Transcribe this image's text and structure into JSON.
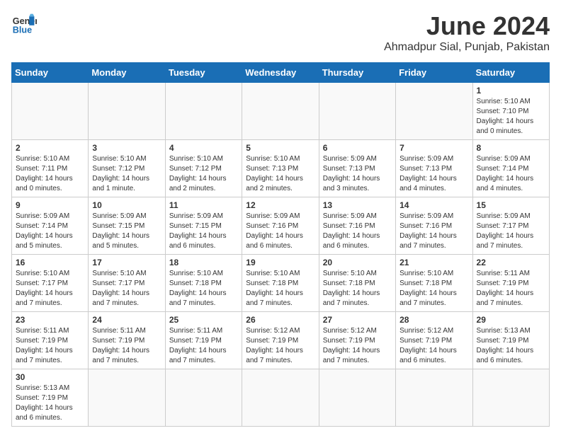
{
  "header": {
    "logo_general": "General",
    "logo_blue": "Blue",
    "month_title": "June 2024",
    "location": "Ahmadpur Sial, Punjab, Pakistan"
  },
  "weekdays": [
    "Sunday",
    "Monday",
    "Tuesday",
    "Wednesday",
    "Thursday",
    "Friday",
    "Saturday"
  ],
  "weeks": [
    [
      {
        "day": "",
        "info": ""
      },
      {
        "day": "",
        "info": ""
      },
      {
        "day": "",
        "info": ""
      },
      {
        "day": "",
        "info": ""
      },
      {
        "day": "",
        "info": ""
      },
      {
        "day": "",
        "info": ""
      },
      {
        "day": "1",
        "info": "Sunrise: 5:10 AM\nSunset: 7:10 PM\nDaylight: 14 hours\nand 0 minutes."
      }
    ],
    [
      {
        "day": "2",
        "info": "Sunrise: 5:10 AM\nSunset: 7:11 PM\nDaylight: 14 hours\nand 0 minutes."
      },
      {
        "day": "3",
        "info": "Sunrise: 5:10 AM\nSunset: 7:12 PM\nDaylight: 14 hours\nand 1 minute."
      },
      {
        "day": "4",
        "info": "Sunrise: 5:10 AM\nSunset: 7:12 PM\nDaylight: 14 hours\nand 2 minutes."
      },
      {
        "day": "5",
        "info": "Sunrise: 5:10 AM\nSunset: 7:13 PM\nDaylight: 14 hours\nand 2 minutes."
      },
      {
        "day": "6",
        "info": "Sunrise: 5:09 AM\nSunset: 7:13 PM\nDaylight: 14 hours\nand 3 minutes."
      },
      {
        "day": "7",
        "info": "Sunrise: 5:09 AM\nSunset: 7:13 PM\nDaylight: 14 hours\nand 4 minutes."
      },
      {
        "day": "8",
        "info": "Sunrise: 5:09 AM\nSunset: 7:14 PM\nDaylight: 14 hours\nand 4 minutes."
      }
    ],
    [
      {
        "day": "9",
        "info": "Sunrise: 5:09 AM\nSunset: 7:14 PM\nDaylight: 14 hours\nand 5 minutes."
      },
      {
        "day": "10",
        "info": "Sunrise: 5:09 AM\nSunset: 7:15 PM\nDaylight: 14 hours\nand 5 minutes."
      },
      {
        "day": "11",
        "info": "Sunrise: 5:09 AM\nSunset: 7:15 PM\nDaylight: 14 hours\nand 6 minutes."
      },
      {
        "day": "12",
        "info": "Sunrise: 5:09 AM\nSunset: 7:16 PM\nDaylight: 14 hours\nand 6 minutes."
      },
      {
        "day": "13",
        "info": "Sunrise: 5:09 AM\nSunset: 7:16 PM\nDaylight: 14 hours\nand 6 minutes."
      },
      {
        "day": "14",
        "info": "Sunrise: 5:09 AM\nSunset: 7:16 PM\nDaylight: 14 hours\nand 7 minutes."
      },
      {
        "day": "15",
        "info": "Sunrise: 5:09 AM\nSunset: 7:17 PM\nDaylight: 14 hours\nand 7 minutes."
      }
    ],
    [
      {
        "day": "16",
        "info": "Sunrise: 5:10 AM\nSunset: 7:17 PM\nDaylight: 14 hours\nand 7 minutes."
      },
      {
        "day": "17",
        "info": "Sunrise: 5:10 AM\nSunset: 7:17 PM\nDaylight: 14 hours\nand 7 minutes."
      },
      {
        "day": "18",
        "info": "Sunrise: 5:10 AM\nSunset: 7:18 PM\nDaylight: 14 hours\nand 7 minutes."
      },
      {
        "day": "19",
        "info": "Sunrise: 5:10 AM\nSunset: 7:18 PM\nDaylight: 14 hours\nand 7 minutes."
      },
      {
        "day": "20",
        "info": "Sunrise: 5:10 AM\nSunset: 7:18 PM\nDaylight: 14 hours\nand 7 minutes."
      },
      {
        "day": "21",
        "info": "Sunrise: 5:10 AM\nSunset: 7:18 PM\nDaylight: 14 hours\nand 7 minutes."
      },
      {
        "day": "22",
        "info": "Sunrise: 5:11 AM\nSunset: 7:19 PM\nDaylight: 14 hours\nand 7 minutes."
      }
    ],
    [
      {
        "day": "23",
        "info": "Sunrise: 5:11 AM\nSunset: 7:19 PM\nDaylight: 14 hours\nand 7 minutes."
      },
      {
        "day": "24",
        "info": "Sunrise: 5:11 AM\nSunset: 7:19 PM\nDaylight: 14 hours\nand 7 minutes."
      },
      {
        "day": "25",
        "info": "Sunrise: 5:11 AM\nSunset: 7:19 PM\nDaylight: 14 hours\nand 7 minutes."
      },
      {
        "day": "26",
        "info": "Sunrise: 5:12 AM\nSunset: 7:19 PM\nDaylight: 14 hours\nand 7 minutes."
      },
      {
        "day": "27",
        "info": "Sunrise: 5:12 AM\nSunset: 7:19 PM\nDaylight: 14 hours\nand 7 minutes."
      },
      {
        "day": "28",
        "info": "Sunrise: 5:12 AM\nSunset: 7:19 PM\nDaylight: 14 hours\nand 6 minutes."
      },
      {
        "day": "29",
        "info": "Sunrise: 5:13 AM\nSunset: 7:19 PM\nDaylight: 14 hours\nand 6 minutes."
      }
    ],
    [
      {
        "day": "30",
        "info": "Sunrise: 5:13 AM\nSunset: 7:19 PM\nDaylight: 14 hours\nand 6 minutes."
      },
      {
        "day": "",
        "info": ""
      },
      {
        "day": "",
        "info": ""
      },
      {
        "day": "",
        "info": ""
      },
      {
        "day": "",
        "info": ""
      },
      {
        "day": "",
        "info": ""
      },
      {
        "day": "",
        "info": ""
      }
    ]
  ]
}
